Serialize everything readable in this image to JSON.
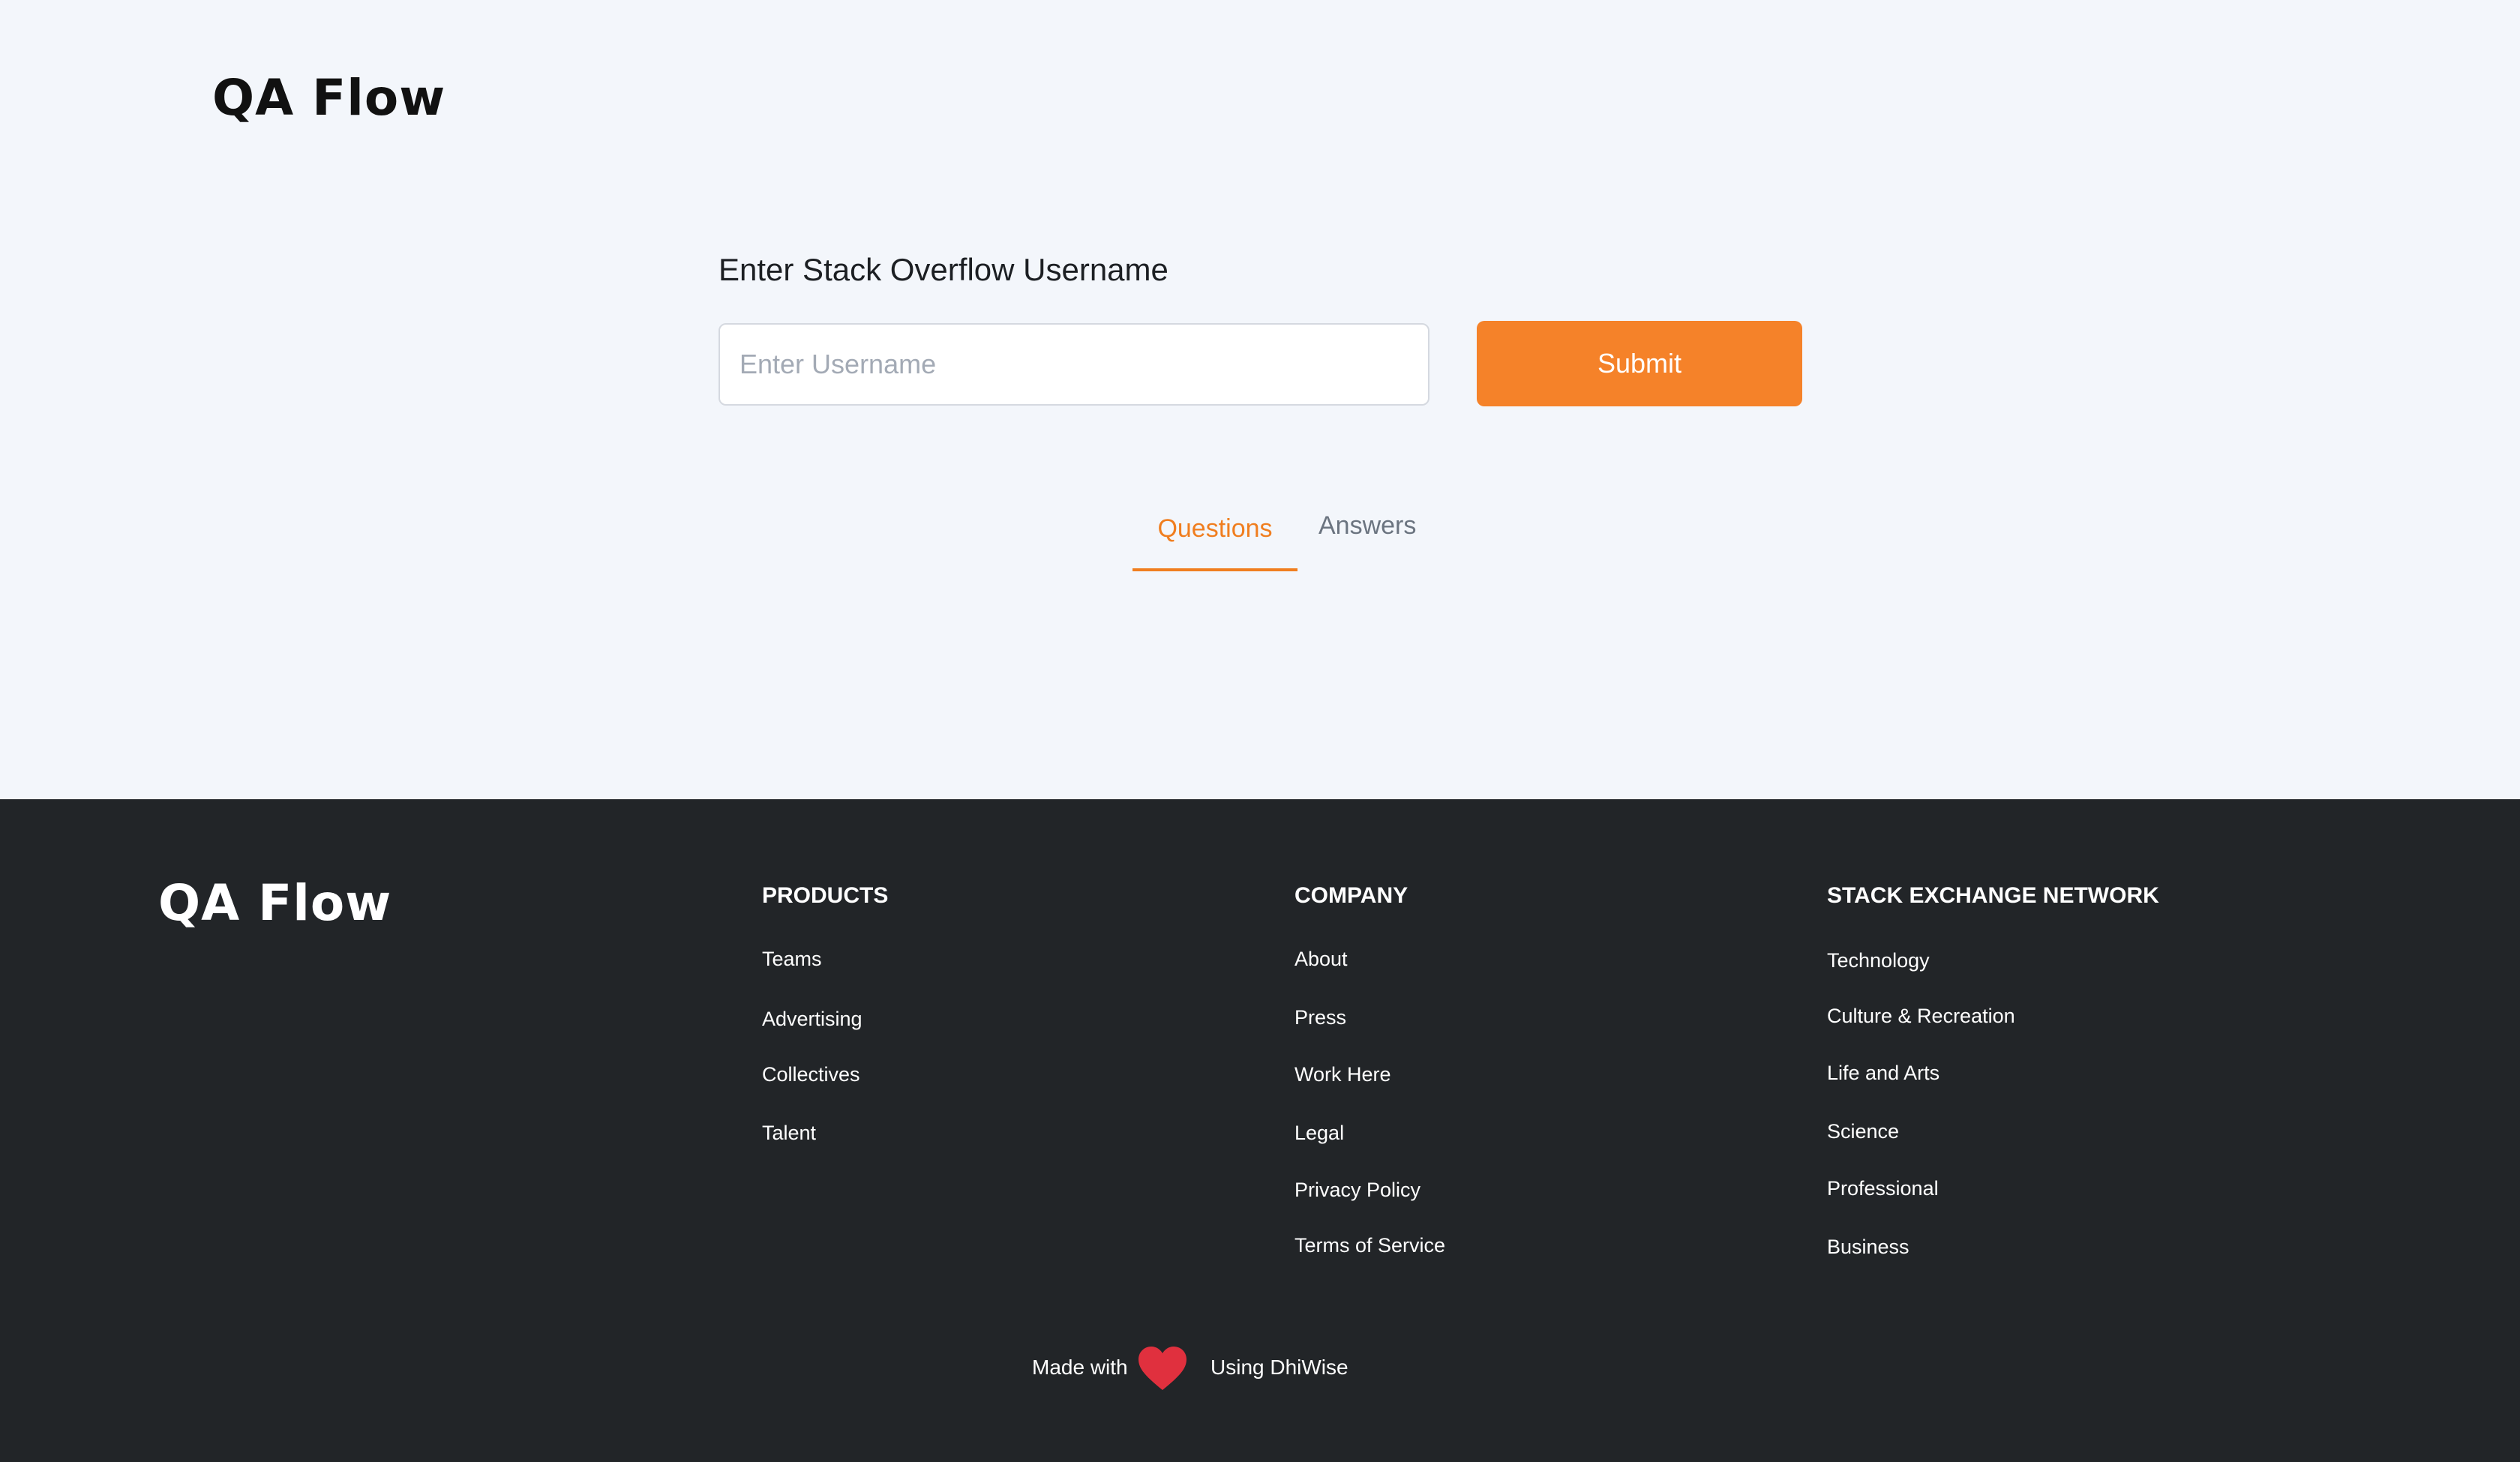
{
  "app": {
    "logo_text": "QA Flow"
  },
  "form": {
    "label": "Enter Stack Overflow Username",
    "input_placeholder": "Enter Username",
    "input_value": "",
    "submit_label": "Submit"
  },
  "tabs": [
    {
      "label": "Questions",
      "active": true
    },
    {
      "label": "Answers",
      "active": false
    }
  ],
  "colors": {
    "accent": "#f58229",
    "footer_bg": "#222528",
    "page_bg": "#f3f6fb",
    "heart": "#e0303e"
  },
  "footer": {
    "logo_text": "QA Flow",
    "columns": [
      {
        "heading": "PRODUCTS",
        "links": [
          "Teams",
          "Advertising",
          "Collectives",
          "Talent"
        ]
      },
      {
        "heading": "COMPANY",
        "links": [
          "About",
          "Press",
          "Work Here",
          "Legal",
          "Privacy Policy",
          "Terms of Service"
        ]
      },
      {
        "heading": "STACK EXCHANGE NETWORK",
        "links": [
          "Technology",
          "Culture & Recreation",
          "Life and Arts",
          "Science",
          "Professional",
          "Business"
        ]
      }
    ],
    "made_with": {
      "prefix": "Made with",
      "icon": "heart-icon",
      "suffix": "Using DhiWise"
    }
  }
}
